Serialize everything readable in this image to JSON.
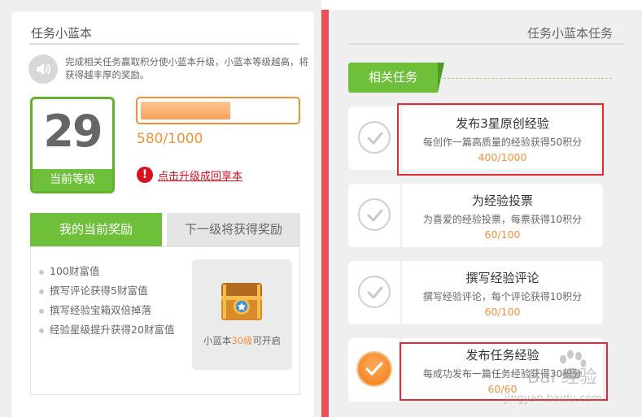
{
  "left": {
    "title": "任务小蓝本",
    "intro": "完成相关任务赢取积分使小蓝本升级，小蓝本等级越高，将获得越丰厚的奖励。",
    "level": {
      "number": "29",
      "label": "当前等级"
    },
    "progress": {
      "text": "580/1000",
      "fraction": 0.58
    },
    "upgrade_link": "点击升级成回享本",
    "tabs": {
      "current": "我的当前奖励",
      "next": "下一级将获得奖励"
    },
    "rewards": [
      "100财富值",
      "撰写评论获得5财富值",
      "撰写经验宝箱双倍掉落",
      "经验星级提升获得20财富值"
    ],
    "chest": {
      "prefix": "小蓝本",
      "level": "30级",
      "suffix": "可开启"
    }
  },
  "right": {
    "title": "任务小蓝本任务",
    "section": "相关任务",
    "tasks": [
      {
        "title": "发布3星原创经验",
        "desc": "每创作一篇高质量的经验获得50积分",
        "progress": "400/1000",
        "done": false
      },
      {
        "title": "为经验投票",
        "desc": "为喜爱的经验投票，每票获得10积分",
        "progress": "60/100",
        "done": false
      },
      {
        "title": "撰写经验评论",
        "desc": "撰写经验评论，每个评论获得10积分",
        "progress": "60/100",
        "done": false
      },
      {
        "title": "发布任务经验",
        "desc": "每成功发布一篇任务经验获得30积分",
        "progress": "60/60",
        "done": true
      }
    ]
  },
  "watermark": {
    "main": "Bai 经验",
    "sub": "jingyan.baidu.com"
  },
  "colors": {
    "green": "#6ec03a",
    "orange": "#f0913a",
    "red": "#e12a32"
  },
  "icons": [
    "speaker-icon",
    "warning-icon",
    "treasure-chest-icon",
    "check-icon"
  ]
}
